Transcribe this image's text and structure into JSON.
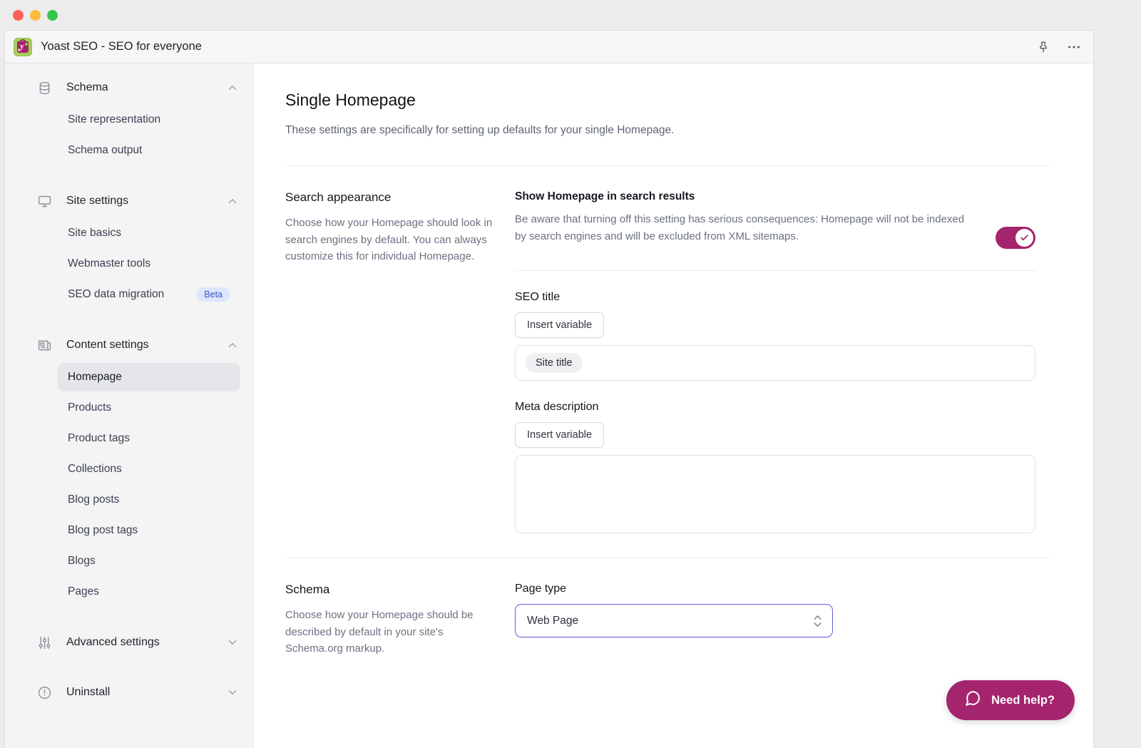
{
  "window": {
    "traffic_lights": [
      "close",
      "minimize",
      "maximize"
    ]
  },
  "header": {
    "title": "Yoast SEO - SEO for everyone",
    "logo_letter": "y",
    "icons": [
      "pin-icon",
      "ellipsis-icon"
    ]
  },
  "sidebar": {
    "groups": [
      {
        "label": "Schema",
        "icon": "database-icon",
        "expanded": true,
        "chevron": "chevron-up-icon",
        "items": [
          {
            "label": "Site representation",
            "active": false
          },
          {
            "label": "Schema output",
            "active": false
          }
        ]
      },
      {
        "label": "Site settings",
        "icon": "monitor-icon",
        "expanded": true,
        "chevron": "chevron-up-icon",
        "items": [
          {
            "label": "Site basics",
            "active": false
          },
          {
            "label": "Webmaster tools",
            "active": false
          },
          {
            "label": "SEO data migration",
            "active": false,
            "badge": "Beta"
          }
        ]
      },
      {
        "label": "Content settings",
        "icon": "newspaper-icon",
        "expanded": true,
        "chevron": "chevron-up-icon",
        "items": [
          {
            "label": "Homepage",
            "active": true
          },
          {
            "label": "Products",
            "active": false
          },
          {
            "label": "Product tags",
            "active": false
          },
          {
            "label": "Collections",
            "active": false
          },
          {
            "label": "Blog posts",
            "active": false
          },
          {
            "label": "Blog post tags",
            "active": false
          },
          {
            "label": "Blogs",
            "active": false
          },
          {
            "label": "Pages",
            "active": false
          }
        ]
      },
      {
        "label": "Advanced settings",
        "icon": "sliders-icon",
        "expanded": false,
        "chevron": "chevron-down-icon",
        "items": []
      },
      {
        "label": "Uninstall",
        "icon": "alert-circle-icon",
        "expanded": false,
        "chevron": "chevron-down-icon",
        "items": []
      }
    ]
  },
  "main": {
    "page_title": "Single Homepage",
    "page_description": "These settings are specifically for setting up defaults for your single Homepage.",
    "search_appearance": {
      "heading": "Search appearance",
      "description": "Choose how your Homepage should look in search engines by default. You can always customize this for individual Homepage.",
      "show_in_search": {
        "label": "Show Homepage in search results",
        "description": "Be aware that turning off this setting has serious consequences: Homepage will not be indexed by search engines and will be excluded from XML sitemaps.",
        "toggle_on": true
      },
      "seo_title": {
        "label": "SEO title",
        "insert_variable_label": "Insert variable",
        "value_chip": "Site title"
      },
      "meta_description": {
        "label": "Meta description",
        "insert_variable_label": "Insert variable",
        "value": ""
      }
    },
    "schema": {
      "heading": "Schema",
      "description": "Choose how your Homepage should be described by default in your site's Schema.org markup.",
      "page_type": {
        "label": "Page type",
        "selected": "Web Page"
      }
    },
    "help_button": {
      "label": "Need help?",
      "icon": "chat-bubble-icon"
    }
  },
  "colors": {
    "brand_magenta": "#a4246d",
    "focus_indigo": "#5c5ce0",
    "badge_blue_bg": "#dde6fb",
    "badge_blue_text": "#3a57c7"
  }
}
